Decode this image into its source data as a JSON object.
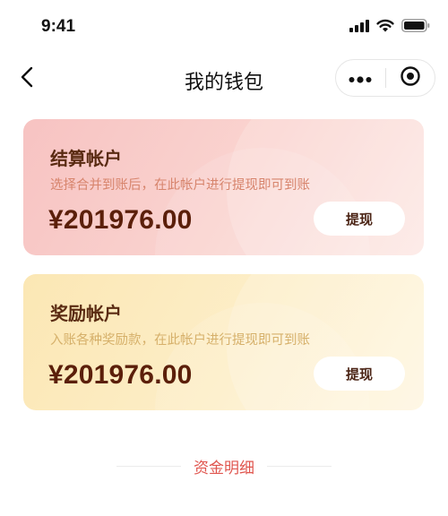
{
  "status_bar": {
    "time": "9:41",
    "icons": [
      "signal-icon",
      "wifi-icon",
      "battery-icon"
    ]
  },
  "nav": {
    "title": "我的钱包",
    "back_icon": "chevron-left-icon",
    "capsule_icons": [
      "more-icon",
      "target-icon"
    ]
  },
  "cards": {
    "settlement": {
      "title": "结算帐户",
      "description": "选择合并到账后，在此帐户进行提现即可到账",
      "amount": "¥201976.00",
      "button": "提现"
    },
    "reward": {
      "title": "奖励帐户",
      "description": "入账各种奖励款，在此帐户进行提现即可到账",
      "amount": "¥201976.00",
      "button": "提现"
    }
  },
  "funds_detail": {
    "label": "资金明细"
  },
  "colors": {
    "accent_red": "#e0564f",
    "amount_brown": "#5b1f0a",
    "settlement_card": "#f7c3c2",
    "reward_card": "#fbe7b4"
  }
}
